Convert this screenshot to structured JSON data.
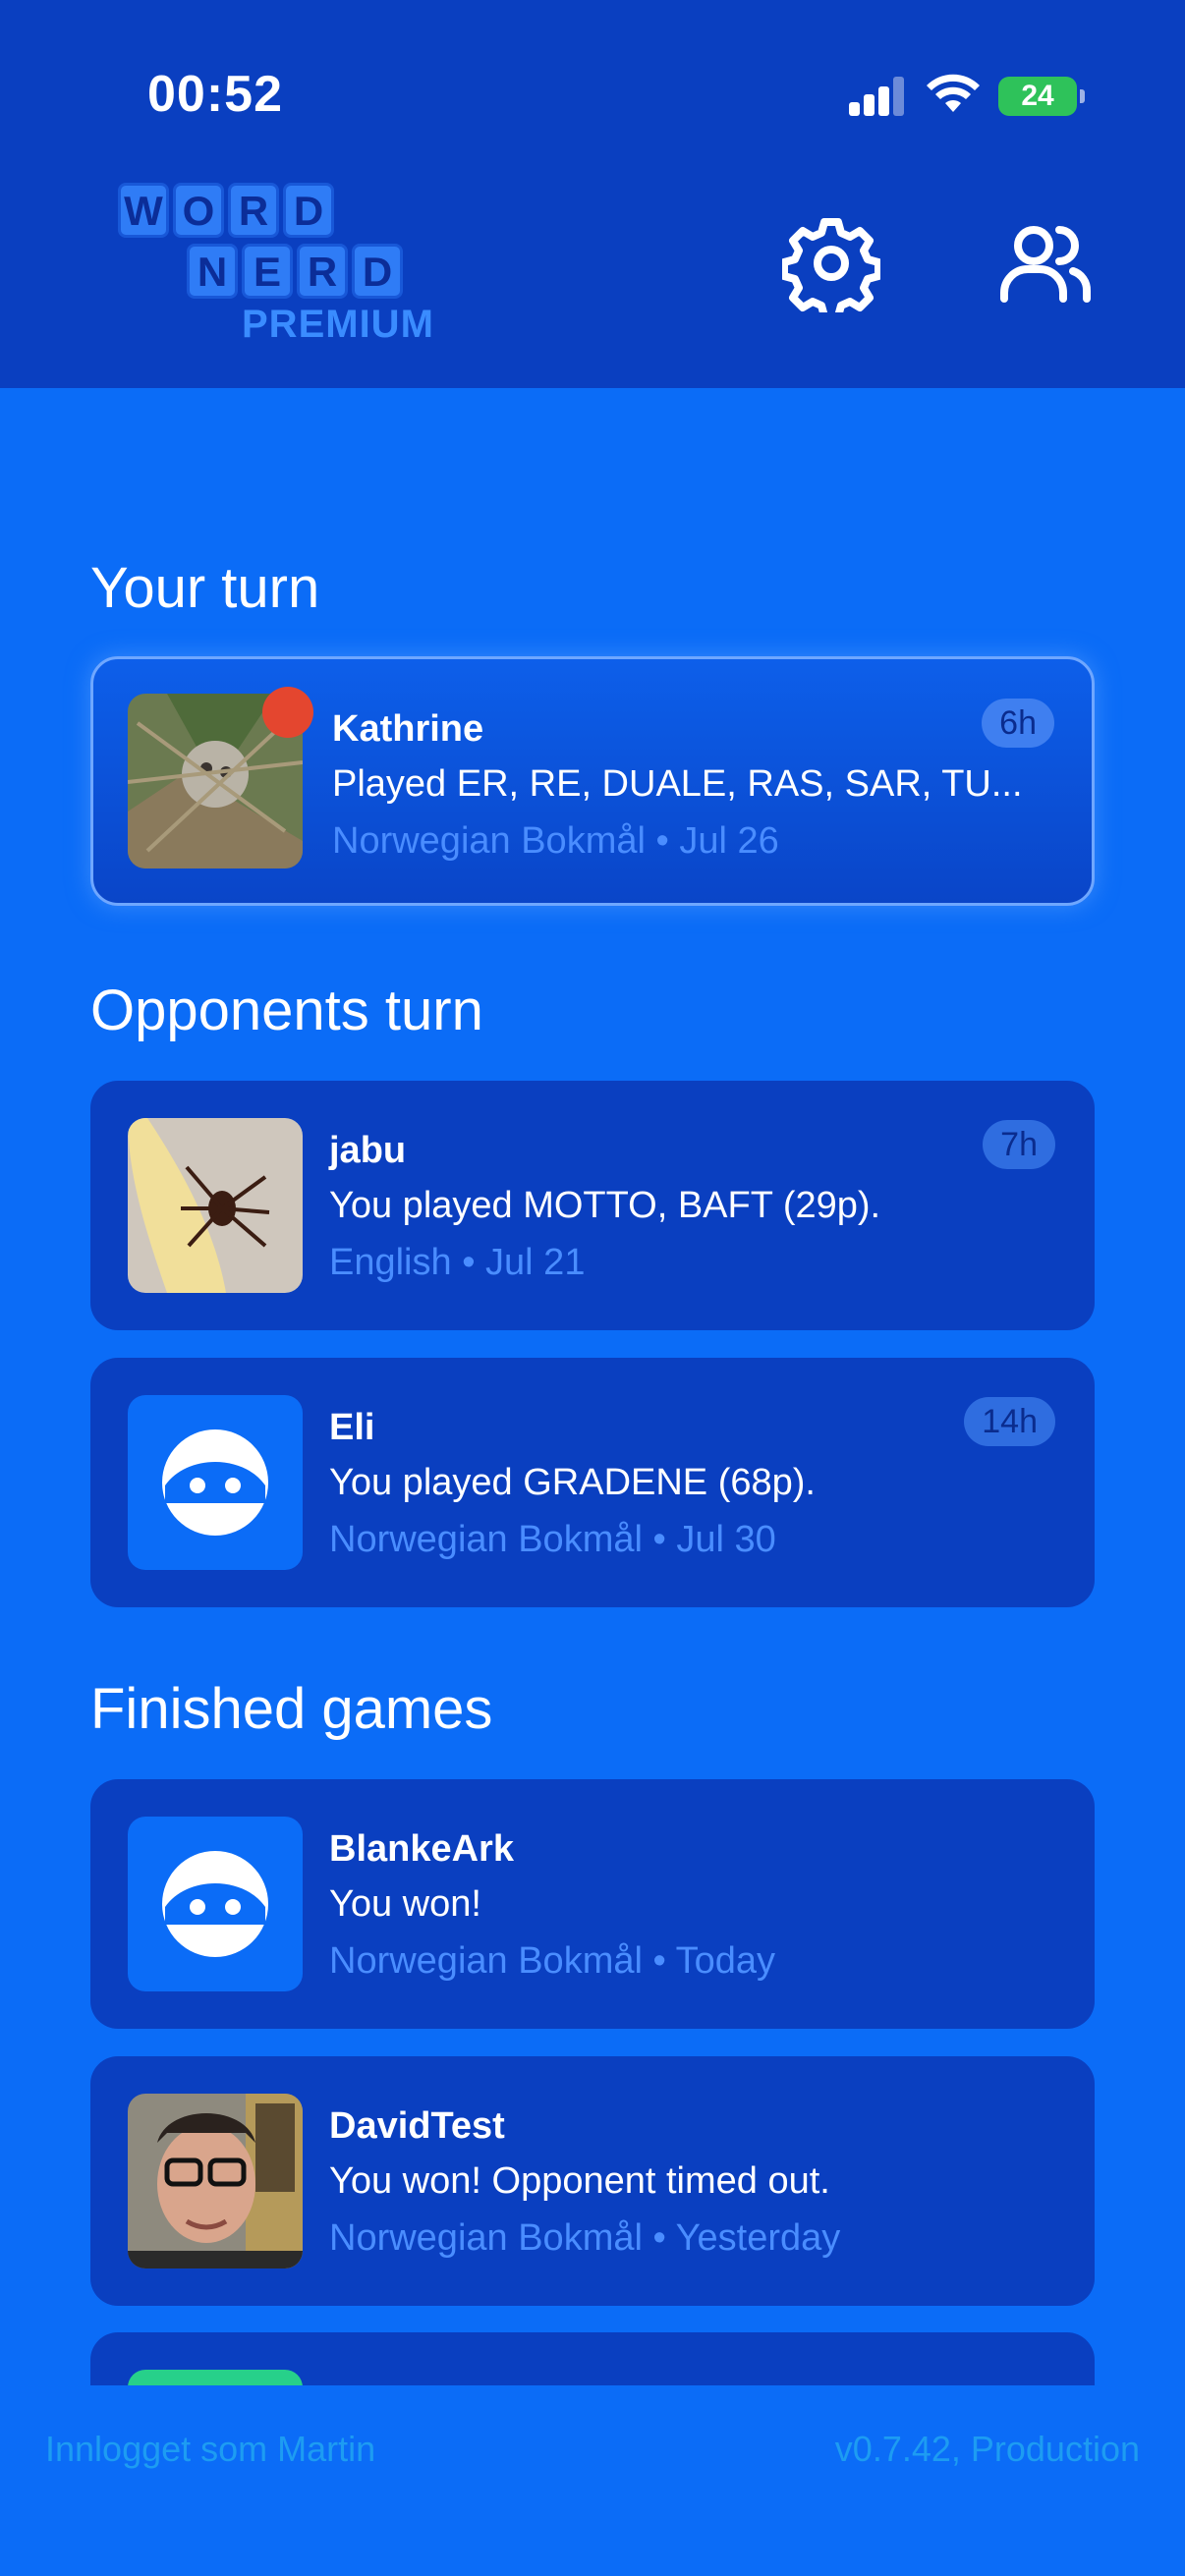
{
  "status_bar": {
    "time": "00:52",
    "battery": "24"
  },
  "logo": {
    "row1": [
      "W",
      "O",
      "R",
      "D"
    ],
    "row2": [
      "N",
      "E",
      "R",
      "D"
    ],
    "subtitle": "PREMIUM"
  },
  "header": {
    "settings_icon": "gear-icon",
    "friends_icon": "users-icon"
  },
  "sections": {
    "your_turn": "Your turn",
    "opponents_turn": "Opponents turn",
    "finished": "Finished games"
  },
  "games": {
    "your_turn": [
      {
        "name": "Kathrine",
        "message": "Played ER, RE, DUALE, RAS, SAR, TU...",
        "meta": "Norwegian Bokmål • Jul 26",
        "badge": "6h",
        "unread": true
      }
    ],
    "opponents_turn": [
      {
        "name": "jabu",
        "message": "You played MOTTO, BAFT (29p).",
        "meta": "English • Jul 21",
        "badge": "7h"
      },
      {
        "name": "Eli",
        "message": "You played GRADENE (68p).",
        "meta": "Norwegian Bokmål • Jul 30",
        "badge": "14h"
      }
    ],
    "finished": [
      {
        "name": "BlankeArk",
        "message": "You won!",
        "meta": "Norwegian Bokmål • Today"
      },
      {
        "name": "DavidTest",
        "message": "You won! Opponent timed out.",
        "meta": "Norwegian Bokmål • Yesterday"
      }
    ]
  },
  "footer": {
    "logged_in": "Innlogget som Martin",
    "version": "v0.7.42, Production"
  },
  "colors": {
    "background": "#0b6cf7",
    "header": "#0a3fc0",
    "card": "#0a3fc0",
    "meta_text": "#4a8dff",
    "notification": "#e4462f"
  }
}
